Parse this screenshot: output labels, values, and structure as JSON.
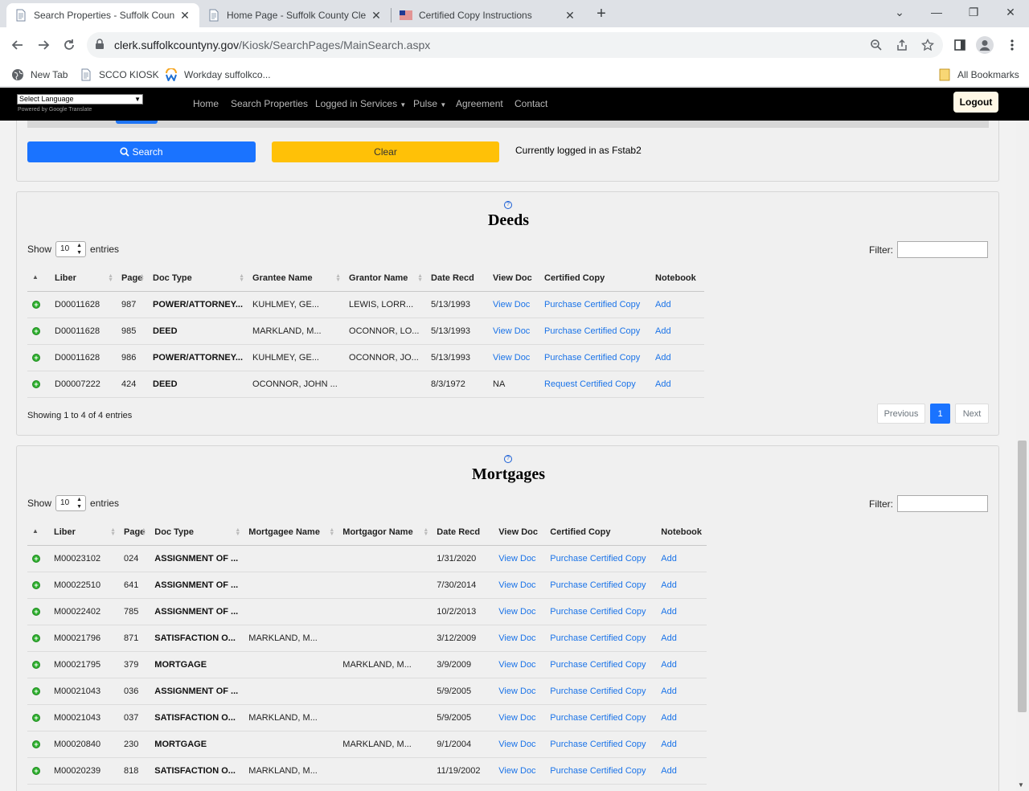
{
  "browser": {
    "tabs": [
      {
        "title": "Search Properties - Suffolk Coun",
        "active": true
      },
      {
        "title": "Home Page - Suffolk County Cle",
        "active": false
      },
      {
        "title": "Certified Copy Instructions",
        "active": false
      }
    ],
    "url_host": "clerk.suffolkcountyny.gov",
    "url_path": "/Kiosk/SearchPages/MainSearch.aspx",
    "bookmarks": [
      "New Tab",
      "SCCO KIOSK",
      "Workday suffolkco..."
    ],
    "all_bookmarks": "All Bookmarks"
  },
  "site": {
    "language_select": "Select Language",
    "powered_by": "Powered by Google Translate",
    "nav": [
      "Home",
      "Search Properties",
      "Logged in Services",
      "Pulse",
      "Agreement",
      "Contact"
    ],
    "logout": "Logout"
  },
  "search": {
    "search_label": "Search",
    "clear_label": "Clear",
    "logged_in_text": "Currently logged in as Fstab2"
  },
  "deeds": {
    "title": "Deeds",
    "show_label": "Show",
    "entries_label": "entries",
    "length": "10",
    "filter_label": "Filter:",
    "columns": [
      "Liber",
      "Page",
      "Doc Type",
      "Grantee Name",
      "Grantor Name",
      "Date Recd",
      "View Doc",
      "Certified Copy",
      "Notebook"
    ],
    "rows": [
      [
        "D00011628",
        "987",
        "POWER/ATTORNEY...",
        "KUHLMEY, GE...",
        "LEWIS, LORR...",
        "5/13/1993",
        "View Doc",
        "Purchase Certified Copy",
        "Add"
      ],
      [
        "D00011628",
        "985",
        "DEED",
        "MARKLAND, M...",
        "OCONNOR, LO...",
        "5/13/1993",
        "View Doc",
        "Purchase Certified Copy",
        "Add"
      ],
      [
        "D00011628",
        "986",
        "POWER/ATTORNEY...",
        "KUHLMEY, GE...",
        "OCONNOR, JO...",
        "5/13/1993",
        "View Doc",
        "Purchase Certified Copy",
        "Add"
      ],
      [
        "D00007222",
        "424",
        "DEED",
        "OCONNOR, JOHN ...",
        "",
        "8/3/1972",
        "NA",
        "Request Certified Copy",
        "Add"
      ]
    ],
    "showing": "Showing 1 to 4 of 4 entries",
    "pager": {
      "previous": "Previous",
      "current": "1",
      "next": "Next"
    }
  },
  "mortgages": {
    "title": "Mortgages",
    "show_label": "Show",
    "entries_label": "entries",
    "length": "10",
    "filter_label": "Filter:",
    "columns": [
      "Liber",
      "Page",
      "Doc Type",
      "Mortgagee Name",
      "Mortgagor Name",
      "Date Recd",
      "View Doc",
      "Certified Copy",
      "Notebook"
    ],
    "rows": [
      [
        "M00023102",
        "024",
        "ASSIGNMENT OF ...",
        "",
        "",
        "1/31/2020",
        "View Doc",
        "Purchase Certified Copy",
        "Add"
      ],
      [
        "M00022510",
        "641",
        "ASSIGNMENT OF ...",
        "",
        "",
        "7/30/2014",
        "View Doc",
        "Purchase Certified Copy",
        "Add"
      ],
      [
        "M00022402",
        "785",
        "ASSIGNMENT OF ...",
        "",
        "",
        "10/2/2013",
        "View Doc",
        "Purchase Certified Copy",
        "Add"
      ],
      [
        "M00021796",
        "871",
        "SATISFACTION O...",
        "MARKLAND, M...",
        "",
        "3/12/2009",
        "View Doc",
        "Purchase Certified Copy",
        "Add"
      ],
      [
        "M00021795",
        "379",
        "MORTGAGE",
        "",
        "MARKLAND, M...",
        "3/9/2009",
        "View Doc",
        "Purchase Certified Copy",
        "Add"
      ],
      [
        "M00021043",
        "036",
        "ASSIGNMENT OF ...",
        "",
        "",
        "5/9/2005",
        "View Doc",
        "Purchase Certified Copy",
        "Add"
      ],
      [
        "M00021043",
        "037",
        "SATISFACTION O...",
        "MARKLAND, M...",
        "",
        "5/9/2005",
        "View Doc",
        "Purchase Certified Copy",
        "Add"
      ],
      [
        "M00020840",
        "230",
        "MORTGAGE",
        "",
        "MARKLAND, M...",
        "9/1/2004",
        "View Doc",
        "Purchase Certified Copy",
        "Add"
      ],
      [
        "M00020239",
        "818",
        "SATISFACTION O...",
        "MARKLAND, M...",
        "",
        "11/19/2002",
        "View Doc",
        "Purchase Certified Copy",
        "Add"
      ]
    ]
  },
  "icons": {
    "tab_favicon": "document-icon",
    "flag_favicon": "us-flag-icon",
    "lock": "lock-icon",
    "row_expand": "plus-circle-icon",
    "help": "help-circle-icon"
  },
  "colors": {
    "primary": "#1a73ff",
    "clear": "#ffc107",
    "link": "#1a73e8",
    "navbar": "#000000"
  }
}
